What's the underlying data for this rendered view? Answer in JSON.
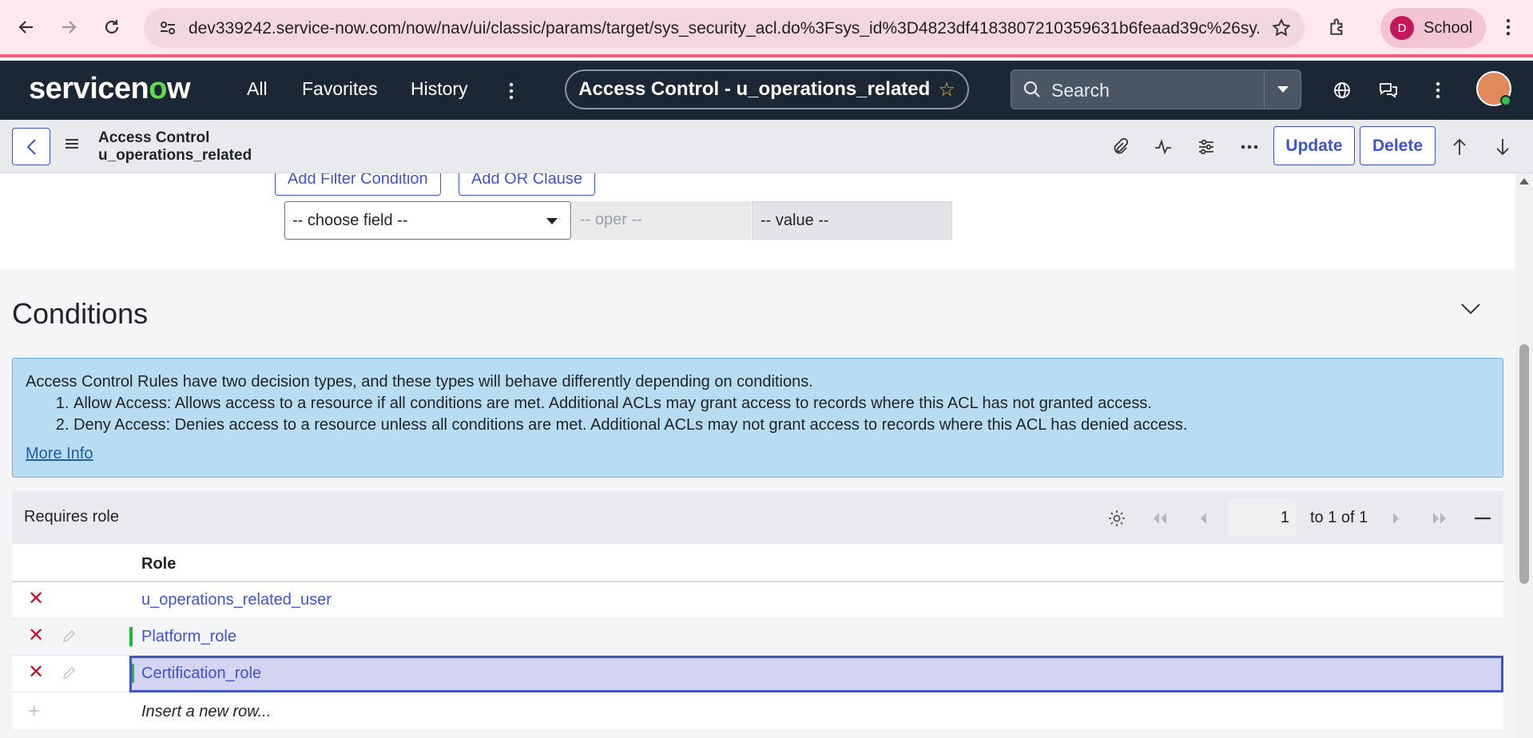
{
  "browser": {
    "url": "dev339242.service-now.com/now/nav/ui/classic/params/target/sys_security_acl.do%3Fsys_id%3D4823df4183807210359631b6feaad39c%26sy...",
    "profile_initial": "D",
    "profile_name": "School"
  },
  "header": {
    "logo_pre": "servicen",
    "logo_o": "o",
    "logo_post": "w",
    "nav_all": "All",
    "nav_favorites": "Favorites",
    "nav_history": "History",
    "context_title": "Access Control - u_operations_related",
    "search_placeholder": "Search"
  },
  "form": {
    "title_line1": "Access Control",
    "title_line2": "u_operations_related",
    "update_label": "Update",
    "delete_label": "Delete"
  },
  "filter": {
    "add_filter_condition": "Add Filter Condition",
    "add_or_clause": "Add OR Clause",
    "choose_field": "-- choose field --",
    "oper": "-- oper --",
    "value": "-- value --"
  },
  "conditions": {
    "title": "Conditions",
    "info_intro": "Access Control Rules have two decision types, and these types will behave differently depending on conditions.",
    "info_item1": "Allow Access: Allows access to a resource if all conditions are met. Additional ACLs may grant access to records where this ACL has not granted access.",
    "info_item2": "Deny Access: Denies access to a resource unless all conditions are met. Additional ACLs may not grant access to records where this ACL has denied access.",
    "more_info": "More Info"
  },
  "related_list": {
    "title": "Requires role",
    "page_value": "1",
    "count_text": "to 1 of 1",
    "column_role": "Role",
    "rows": [
      {
        "role": "u_operations_related_user"
      },
      {
        "role": "Platform_role"
      },
      {
        "role": "Certification_role"
      }
    ],
    "insert_row": "Insert a new row..."
  },
  "colors": {
    "brand_header": "#1b2734",
    "accent": "#3f54c9",
    "delete_red": "#c8102e",
    "info_bg": "#b8dcf1",
    "green_mark": "#1fb83b"
  }
}
